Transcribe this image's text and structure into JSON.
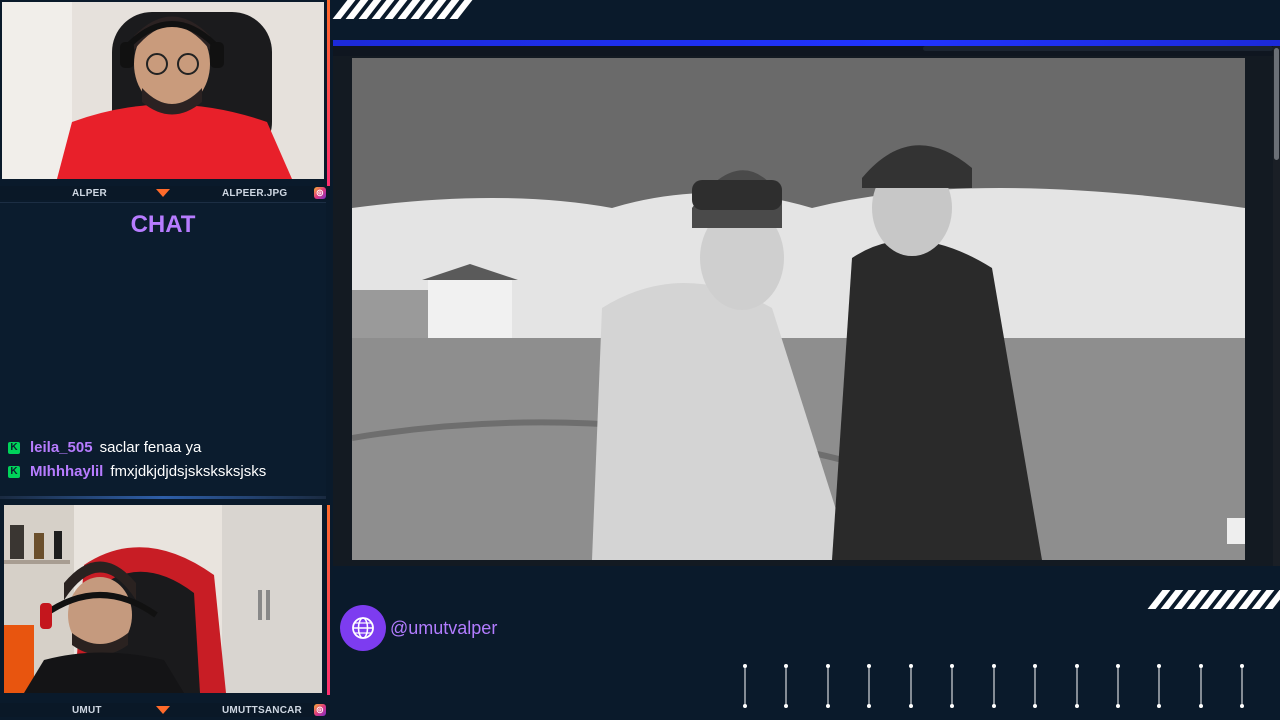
{
  "cams": {
    "top": {
      "left_name": "ALPER",
      "right_name": "ALPEER.JPG"
    },
    "bottom": {
      "left_name": "UMUT",
      "right_name": "UMUTTSANCAR"
    }
  },
  "chat": {
    "title": "CHAT",
    "messages": [
      {
        "badge": "K",
        "user": "leila_505",
        "text": "saclar fenaa ya"
      },
      {
        "badge": "K",
        "user": "MIhhhaylil",
        "text": "fmxjdkjdjdsjsksksksjsks"
      }
    ]
  },
  "social": {
    "handle": "@umutvalper",
    "icon": "globe-icon"
  },
  "colors": {
    "accent_purple": "#b77cff",
    "accent_orange": "#ff6a2a",
    "bar_blue": "#2034ff",
    "background": "#0a1a2b"
  }
}
